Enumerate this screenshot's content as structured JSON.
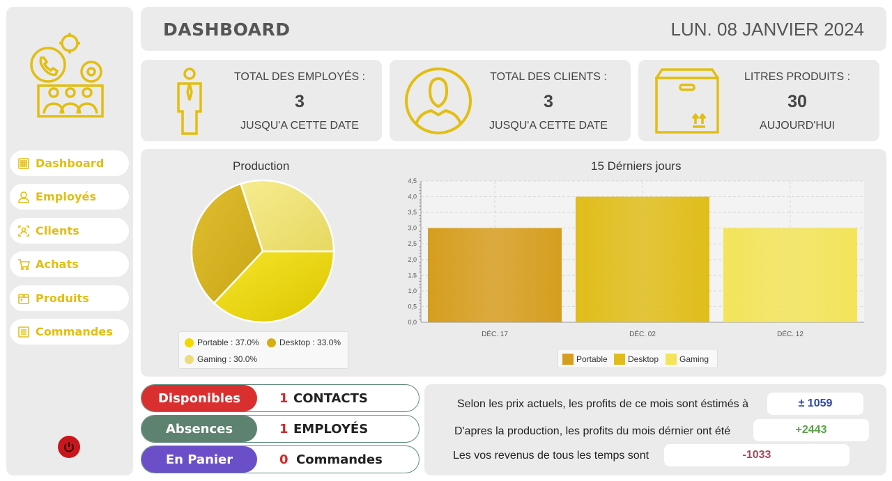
{
  "sidebar": {
    "items": [
      {
        "label": "Dashboard",
        "icon": "dashboard-icon"
      },
      {
        "label": "Employés",
        "icon": "user-icon"
      },
      {
        "label": "Clients",
        "icon": "client-icon"
      },
      {
        "label": "Achats",
        "icon": "cart-icon"
      },
      {
        "label": "Produits",
        "icon": "box-icon"
      },
      {
        "label": "Commandes",
        "icon": "list-icon"
      }
    ],
    "logo_icon": "business-logo-icon",
    "power_icon": "power-icon"
  },
  "header": {
    "title": "DASHBOARD",
    "date": "LUN. 08 JANVIER 2024"
  },
  "cards": [
    {
      "title": "TOTAL DES EMPLOYÉS :",
      "value": "3",
      "subtitle": "JUSQU'A CETTE DATE",
      "icon": "employee-icon"
    },
    {
      "title": "TOTAL DES CLIENTS :",
      "value": "3",
      "subtitle": "JUSQU'A CETTE DATE",
      "icon": "client-avatar-icon"
    },
    {
      "title": "LITRES PRODUITS :",
      "value": "30",
      "subtitle": "AUJOURD'HUI",
      "icon": "package-icon"
    }
  ],
  "chart_data": [
    {
      "type": "pie",
      "title": "Production",
      "slices": [
        {
          "label": "Portable",
          "value": 37.0,
          "color": "#e8d20a"
        },
        {
          "label": "Desktop",
          "value": 33.0,
          "color": "#d6b21e"
        },
        {
          "label": "Gaming",
          "value": 30.0,
          "color": "#ede27a"
        }
      ],
      "legend": [
        "Portable : 37.0%",
        "Desktop : 33.0%",
        "Gaming : 30.0%"
      ]
    },
    {
      "type": "bar",
      "title": "15 Dérniers jours",
      "categories": [
        "DÉC. 17",
        "DÉC. 02",
        "DÉC. 12"
      ],
      "series": [
        {
          "name": "Portable",
          "values": [
            3.0,
            0,
            0
          ],
          "color": "#d69e1f"
        },
        {
          "name": "Desktop",
          "values": [
            0,
            4.0,
            0
          ],
          "color": "#e0bd1a"
        },
        {
          "name": "Gaming",
          "values": [
            0,
            0,
            3.0
          ],
          "color": "#f3e45a"
        }
      ],
      "ylim": [
        0,
        4.5
      ],
      "yticks": [
        "0,0",
        "0,5",
        "1,0",
        "1,5",
        "2,0",
        "2,5",
        "3,0",
        "3,5",
        "4,0",
        "4,5"
      ],
      "grid": true,
      "legend_position": "bottom"
    }
  ],
  "status": [
    {
      "tag": "Disponibles",
      "count": "1",
      "unit": "CONTACTS",
      "color": "#d9302f"
    },
    {
      "tag": "Absences",
      "count": "1",
      "unit": "EMPLOYÉS",
      "color": "#5e8270"
    },
    {
      "tag": "En Panier",
      "count": "0",
      "unit": "Commandes",
      "color": "#6a4fc8"
    }
  ],
  "profits": [
    {
      "text": "Selon les prix actuels, les profits de ce mois sont éstimés à",
      "value": "± 1059",
      "color": "#2d47a8"
    },
    {
      "text": "D'apres la production, les profits du mois dérnier ont été",
      "value": "+2443",
      "color": "#5aa04a"
    },
    {
      "text": "Les vos revenus de tous les temps sont",
      "value": "-1033",
      "color": "#a04a5a"
    }
  ]
}
